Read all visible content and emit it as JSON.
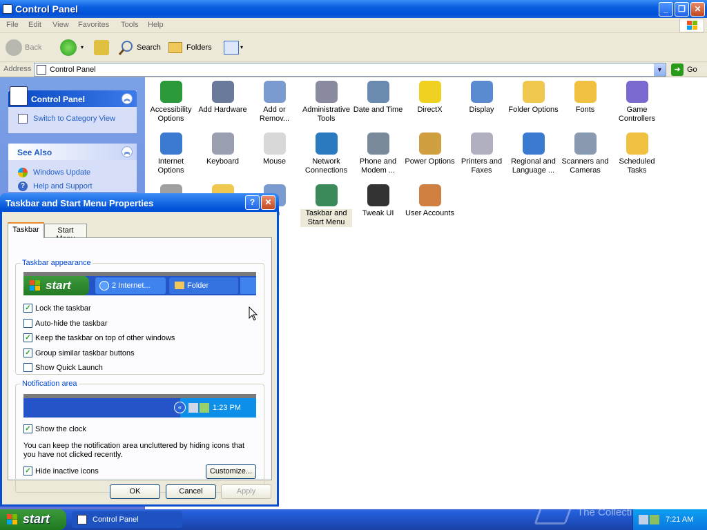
{
  "window": {
    "title": "Control Panel"
  },
  "menubar": {
    "items": [
      "File",
      "Edit",
      "View",
      "Favorites",
      "Tools",
      "Help"
    ]
  },
  "toolbar": {
    "back": "Back",
    "search": "Search",
    "folders": "Folders"
  },
  "address": {
    "label": "Address",
    "value": "Control Panel",
    "go": "Go"
  },
  "leftpanel": {
    "control_panel": {
      "title": "Control Panel",
      "switch_view": "Switch to Category View"
    },
    "see_also": {
      "title": "See Also",
      "links": [
        "Windows Update",
        "Help and Support"
      ]
    }
  },
  "icons": [
    {
      "label": "Accessibility Options",
      "icon": "accessibility-icon"
    },
    {
      "label": "Add Hardware",
      "icon": "add-hardware-icon"
    },
    {
      "label": "Add or Remov...",
      "icon": "add-remove-programs-icon"
    },
    {
      "label": "Administrative Tools",
      "icon": "admin-tools-icon"
    },
    {
      "label": "Date and Time",
      "icon": "date-time-icon"
    },
    {
      "label": "DirectX",
      "icon": "directx-icon"
    },
    {
      "label": "Display",
      "icon": "display-icon"
    },
    {
      "label": "Folder Options",
      "icon": "folder-options-icon"
    },
    {
      "label": "Fonts",
      "icon": "fonts-icon"
    },
    {
      "label": "Game Controllers",
      "icon": "game-controllers-icon"
    },
    {
      "label": "Internet Options",
      "icon": "internet-options-icon"
    },
    {
      "label": "Keyboard",
      "icon": "keyboard-icon"
    },
    {
      "label": "Mouse",
      "icon": "mouse-icon"
    },
    {
      "label": "Network Connections",
      "icon": "network-icon"
    },
    {
      "label": "Phone and Modem ...",
      "icon": "phone-modem-icon"
    },
    {
      "label": "Power Options",
      "icon": "power-icon"
    },
    {
      "label": "Printers and Faxes",
      "icon": "printer-icon"
    },
    {
      "label": "Regional and Language ...",
      "icon": "regional-icon"
    },
    {
      "label": "Scanners and Cameras",
      "icon": "scanner-icon"
    },
    {
      "label": "Scheduled Tasks",
      "icon": "scheduled-tasks-icon"
    },
    {
      "label": "",
      "icon": "sounds-icon"
    },
    {
      "label": "",
      "icon": "speech-icon"
    },
    {
      "label": "em",
      "icon": "system-icon"
    },
    {
      "label": "Taskbar and Start Menu",
      "icon": "taskbar-icon"
    },
    {
      "label": "Tweak UI",
      "icon": "tweakui-icon"
    },
    {
      "label": "User Accounts",
      "icon": "user-accounts-icon"
    }
  ],
  "dialog": {
    "title": "Taskbar and Start Menu Properties",
    "help": "?",
    "tabs": [
      "Taskbar",
      "Start Menu"
    ],
    "appearance": {
      "title": "Taskbar appearance",
      "preview": {
        "start": "start",
        "button1": "2 Internet...",
        "button2": "Folder"
      },
      "options": [
        {
          "label": "Lock the taskbar",
          "checked": true
        },
        {
          "label": "Auto-hide the taskbar",
          "checked": false
        },
        {
          "label": "Keep the taskbar on top of other windows",
          "checked": true
        },
        {
          "label": "Group similar taskbar buttons",
          "checked": true
        },
        {
          "label": "Show Quick Launch",
          "checked": false
        }
      ]
    },
    "notification": {
      "title": "Notification area",
      "preview_time": "1:23 PM",
      "show_clock": "Show the clock",
      "description": "You can keep the notification area uncluttered by hiding icons that you have not clicked recently.",
      "hide_inactive": "Hide inactive icons",
      "customize": "Customize..."
    },
    "buttons": {
      "ok": "OK",
      "cancel": "Cancel",
      "apply": "Apply"
    }
  },
  "taskbar": {
    "start": "start",
    "task": "Control Panel",
    "watermark": "The Collection Book",
    "time": "7:21 AM"
  }
}
